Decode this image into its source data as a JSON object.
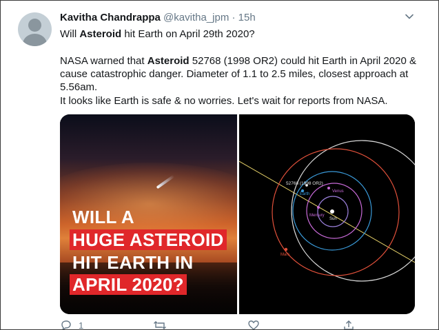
{
  "tweet": {
    "author_name": "Kavitha Chandrappa",
    "handle": "@kavitha_jpm",
    "separator": "·",
    "time": "15h",
    "line1_word": "Asteroid",
    "line1_pre": "Will ",
    "line1_post": " hit Earth on April 29th 2020?",
    "para_pre": "NASA warned that ",
    "para_word": "Asteroid",
    "para_post": " 52768 (1998 OR2) could hit Earth in April 2020 & cause catastrophic danger. Diameter of 1.1 to 2.5 miles, closest approach at 5.56am.",
    "line3": "It looks like Earth is safe & no worries. Let's wait for reports from NASA."
  },
  "media": {
    "left_headline": [
      "WILL A",
      "HUGE ASTEROID",
      "HIT EARTH IN",
      "APRIL 2020?"
    ],
    "orbit_labels": {
      "asteroid": "52768 (1998 OR2)",
      "earth": "Earth",
      "venus": "Venus",
      "mercury": "Mercury",
      "sun": "Sun",
      "mars": "Mars"
    },
    "orbit_colors": {
      "asteroid": "#d9d9d9",
      "earth": "#3a9ad9",
      "venus": "#c86ad8",
      "mercury": "#9a7fd9",
      "mars": "#e0503a",
      "sun_path": "#e8d36a"
    }
  },
  "actions": {
    "reply_count": "1",
    "icons": [
      "reply-icon",
      "retweet-icon",
      "like-icon",
      "share-icon"
    ]
  },
  "colors": {
    "text": "#14171a",
    "muted": "#657786",
    "headline_red": "#e0272a"
  }
}
